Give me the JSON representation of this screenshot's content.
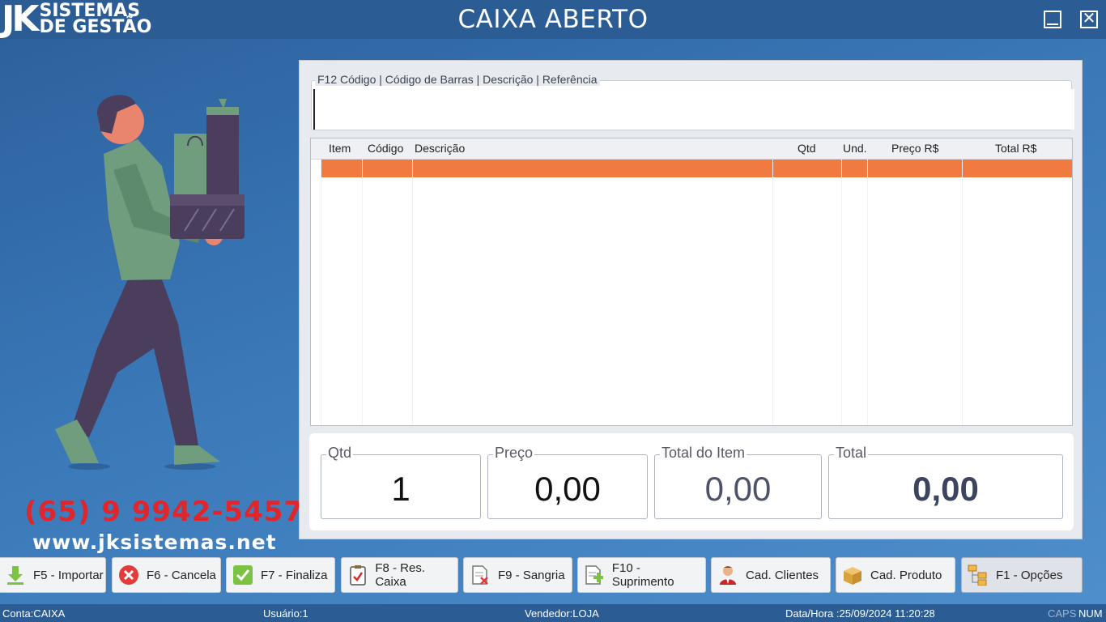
{
  "app": {
    "logo_jk": "JK",
    "logo_line1": "SISTEMAS",
    "logo_line2": "DE GESTÃO",
    "title": "CAIXA ABERTO"
  },
  "promo": {
    "phone": "(65) 9 9942-5457",
    "website": "www.jksistemas.net"
  },
  "search": {
    "legend": "F12  Código | Código de Barras | Descrição | Referência",
    "value": ""
  },
  "grid": {
    "columns": [
      "Item",
      "Código",
      "Descrição",
      "Qtd",
      "Und.",
      "Preço R$",
      "Total R$"
    ],
    "rows": []
  },
  "totals": {
    "qtd_label": "Qtd",
    "qtd_value": "1",
    "preco_label": "Preço",
    "preco_value": "0,00",
    "item_label": "Total do Item",
    "item_value": "0,00",
    "total_label": "Total",
    "total_value": "0,00"
  },
  "buttons": [
    {
      "label": "F5 - Importar",
      "icon": "download-icon"
    },
    {
      "label": "F6 - Cancela",
      "icon": "cancel-icon"
    },
    {
      "label": "F7 - Finaliza",
      "icon": "check-icon"
    },
    {
      "label": "F8 - Res. Caixa",
      "icon": "clipboard-icon"
    },
    {
      "label": "F9 - Sangria",
      "icon": "document-remove-icon"
    },
    {
      "label": "F10 - Suprimento",
      "icon": "document-add-icon"
    },
    {
      "label": "Cad. Clientes",
      "icon": "user-icon"
    },
    {
      "label": "Cad. Produto",
      "icon": "box-icon"
    },
    {
      "label": "F1 - Opções",
      "icon": "hierarchy-icon"
    }
  ],
  "status": {
    "conta": "Conta:CAIXA",
    "usuario": "Usuário:1",
    "vendedor": "Vendedor:LOJA",
    "datahora": "Data/Hora :25/09/2024 11:20:28",
    "caps": "CAPS",
    "num": "NUM"
  },
  "colors": {
    "titlebar": "#2b5c93",
    "selected_row": "#f07a3f",
    "phone_text": "#e0262a"
  }
}
